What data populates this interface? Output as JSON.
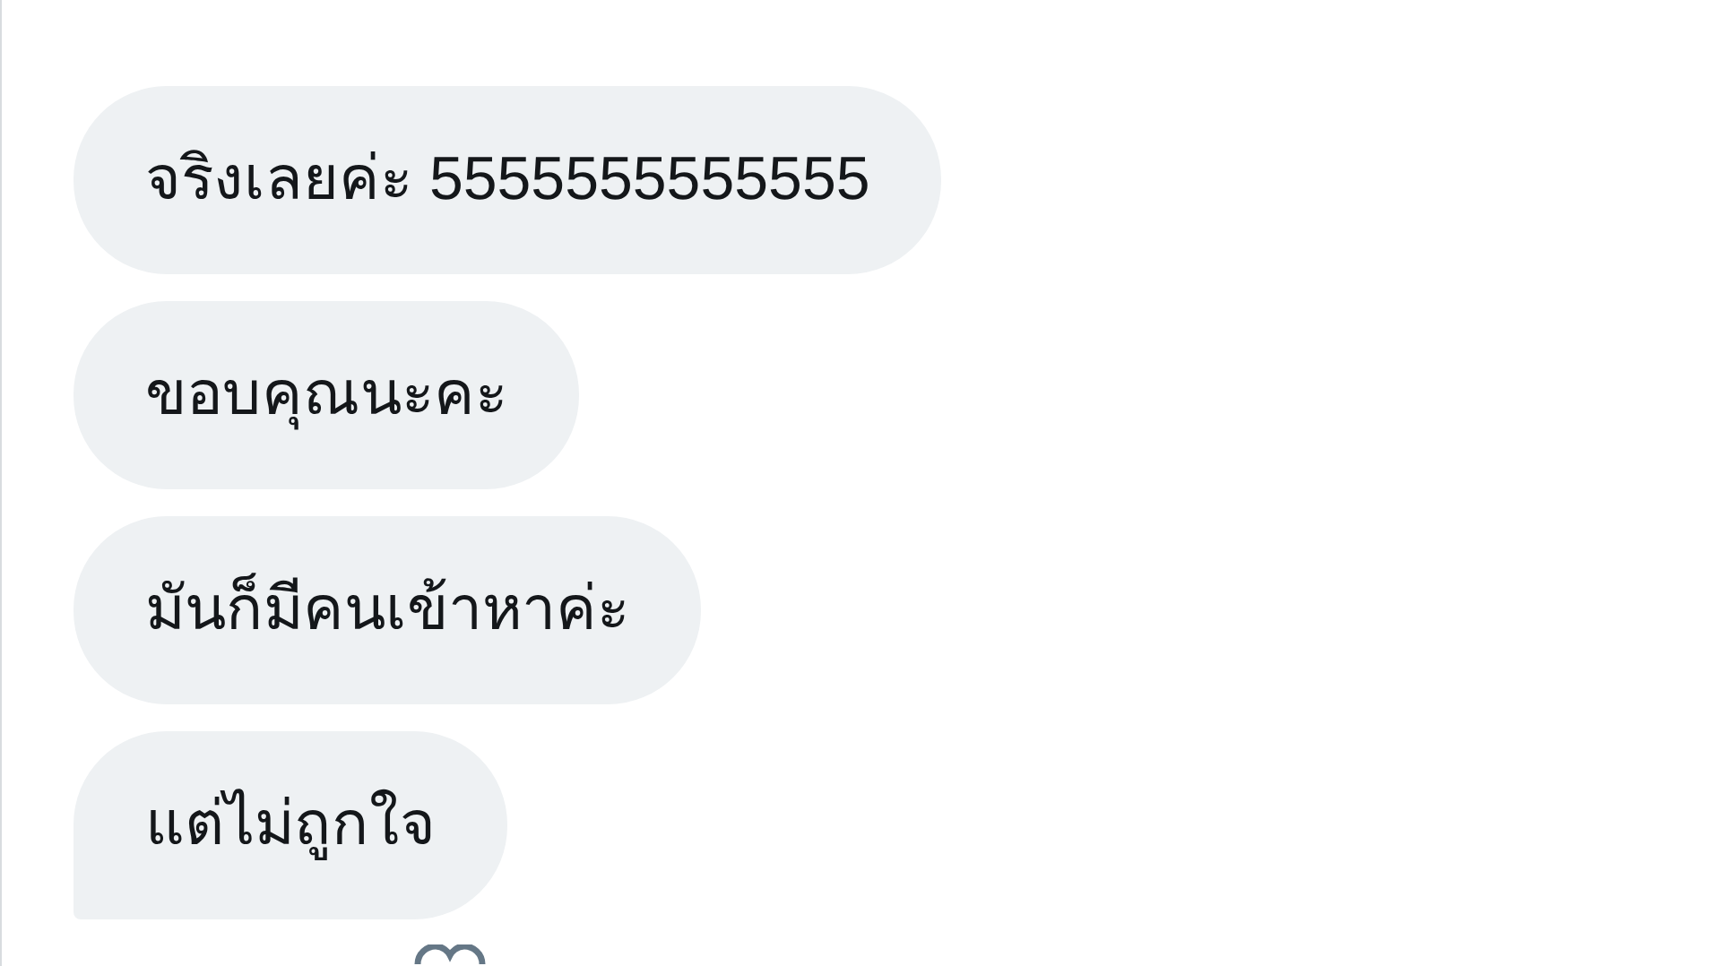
{
  "messages": [
    {
      "text": "จริงเลยค่ะ 5555555555555",
      "tail": false
    },
    {
      "text": "ขอบคุณนะคะ",
      "tail": false
    },
    {
      "text": "มันก็มีคนเข้าหาค่ะ",
      "tail": false
    },
    {
      "text": "แต่ไม่ถูกใจ",
      "tail": true
    }
  ]
}
